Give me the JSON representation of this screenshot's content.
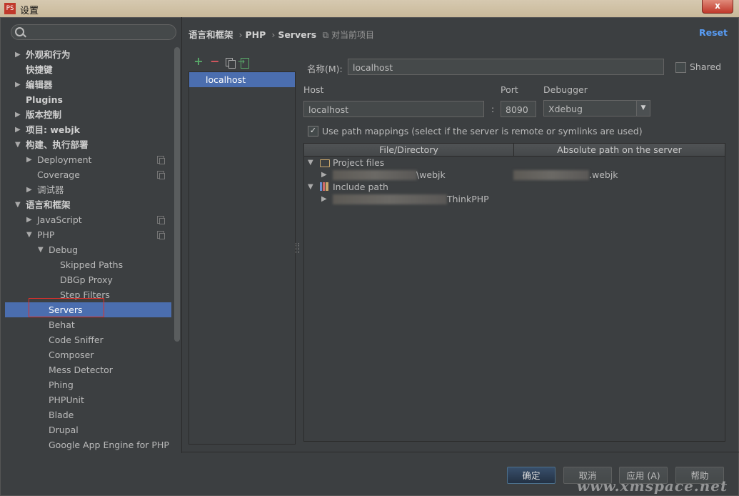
{
  "window": {
    "title": "设置",
    "close_label": "x"
  },
  "sidebar": {
    "items": [
      {
        "label": "外观和行为",
        "arrow": "▶",
        "indent": 0,
        "bold": true
      },
      {
        "label": "快捷键",
        "arrow": "",
        "indent": 0,
        "bold": true
      },
      {
        "label": "编辑器",
        "arrow": "▶",
        "indent": 0,
        "bold": true
      },
      {
        "label": "Plugins",
        "arrow": "",
        "indent": 0,
        "bold": true
      },
      {
        "label": "版本控制",
        "arrow": "▶",
        "indent": 0,
        "bold": true
      },
      {
        "label": "项目: webjk",
        "arrow": "▶",
        "indent": 0,
        "bold": true
      },
      {
        "label": "构建、执行部署",
        "arrow": "▼",
        "indent": 0,
        "bold": true
      },
      {
        "label": "Deployment",
        "arrow": "▶",
        "indent": 1,
        "copy": true
      },
      {
        "label": "Coverage",
        "arrow": "",
        "indent": 1,
        "copy": true
      },
      {
        "label": "调试器",
        "arrow": "▶",
        "indent": 1
      },
      {
        "label": "语言和框架",
        "arrow": "▼",
        "indent": 0,
        "bold": true
      },
      {
        "label": "JavaScript",
        "arrow": "▶",
        "indent": 1,
        "copy": true
      },
      {
        "label": "PHP",
        "arrow": "▼",
        "indent": 1,
        "copy": true
      },
      {
        "label": "Debug",
        "arrow": "▼",
        "indent": 2
      },
      {
        "label": "Skipped Paths",
        "arrow": "",
        "indent": 3
      },
      {
        "label": "DBGp Proxy",
        "arrow": "",
        "indent": 3
      },
      {
        "label": "Step Filters",
        "arrow": "",
        "indent": 3
      },
      {
        "label": "Servers",
        "arrow": "",
        "indent": 2,
        "selected": true
      },
      {
        "label": "Behat",
        "arrow": "",
        "indent": 2
      },
      {
        "label": "Code Sniffer",
        "arrow": "",
        "indent": 2
      },
      {
        "label": "Composer",
        "arrow": "",
        "indent": 2
      },
      {
        "label": "Mess Detector",
        "arrow": "",
        "indent": 2
      },
      {
        "label": "Phing",
        "arrow": "",
        "indent": 2
      },
      {
        "label": "PHPUnit",
        "arrow": "",
        "indent": 2
      },
      {
        "label": "Blade",
        "arrow": "",
        "indent": 2
      },
      {
        "label": "Drupal",
        "arrow": "",
        "indent": 2
      },
      {
        "label": "Google App Engine for PHP",
        "arrow": "",
        "indent": 2
      }
    ]
  },
  "breadcrumb": {
    "part1": "语言和框架",
    "part2": "PHP",
    "part3": "Servers",
    "project_scope": "对当前项目",
    "sep": "›"
  },
  "reset_label": "Reset",
  "server_list": {
    "items": [
      "localhost"
    ]
  },
  "form": {
    "name_label": "名称(M):",
    "name_value": "localhost",
    "shared_label": "Shared",
    "host_label": "Host",
    "host_value": "localhost",
    "colon": ":",
    "port_label": "Port",
    "port_value": "8090",
    "debugger_label": "Debugger",
    "debugger_value": "Xdebug",
    "use_path_label": "Use path mappings (select if the server is remote or symlinks are used)",
    "check_mark": "✓"
  },
  "mapping_table": {
    "columns": [
      "File/Directory",
      "Absolute path on the server"
    ],
    "project_files_label": "Project files",
    "row1_file": "\\webjk",
    "row1_server": ".webjk",
    "include_path_label": "Include path",
    "row2_file": "ThinkPHP"
  },
  "buttons": {
    "ok": "确定",
    "cancel": "取消",
    "apply": "应用 (A)",
    "help": "帮助"
  },
  "watermark": "www.xmspace.net",
  "colors": {
    "selection": "#4b6eaf",
    "link": "#589df6",
    "highlight_box": "#e0302a"
  }
}
